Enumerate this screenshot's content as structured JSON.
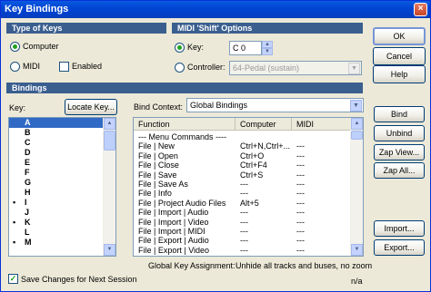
{
  "window": {
    "title": "Key Bindings",
    "close_glyph": "×"
  },
  "type_of_keys": {
    "header": "Type of Keys",
    "computer_label": "Computer",
    "midi_label": "MIDI",
    "enabled_label": "Enabled",
    "selected": "Computer"
  },
  "midi_shift": {
    "header": "MIDI 'Shift' Options",
    "key_label": "Key:",
    "key_value": "C 0",
    "controller_label": "Controller:",
    "controller_value": "64-Pedal (sustain)",
    "selected": "Key"
  },
  "dialog_buttons": {
    "ok": "OK",
    "cancel": "Cancel",
    "help": "Help"
  },
  "bindings": {
    "header": "Bindings",
    "key_label": "Key:",
    "locate_key_button": "Locate Key...",
    "bind_context_label": "Bind Context:",
    "bind_context_value": "Global Bindings",
    "keys": [
      {
        "label": "A",
        "selected": true,
        "marked": false
      },
      {
        "label": "B",
        "selected": false,
        "marked": false
      },
      {
        "label": "C",
        "selected": false,
        "marked": false
      },
      {
        "label": "D",
        "selected": false,
        "marked": false
      },
      {
        "label": "E",
        "selected": false,
        "marked": false
      },
      {
        "label": "F",
        "selected": false,
        "marked": false
      },
      {
        "label": "G",
        "selected": false,
        "marked": false
      },
      {
        "label": "H",
        "selected": false,
        "marked": false
      },
      {
        "label": "I",
        "selected": false,
        "marked": true
      },
      {
        "label": "J",
        "selected": false,
        "marked": false
      },
      {
        "label": "K",
        "selected": false,
        "marked": true
      },
      {
        "label": "L",
        "selected": false,
        "marked": false
      },
      {
        "label": "M",
        "selected": false,
        "marked": true
      }
    ],
    "marker_glyph": "▪",
    "columns": [
      "Function",
      "Computer",
      "MIDI"
    ],
    "rows": [
      {
        "function": "--- Menu Commands ----",
        "computer": "",
        "midi": ""
      },
      {
        "function": "File | New",
        "computer": "Ctrl+N,Ctrl+...",
        "midi": "---"
      },
      {
        "function": "File | Open",
        "computer": "Ctrl+O",
        "midi": "---"
      },
      {
        "function": "File | Close",
        "computer": "Ctrl+F4",
        "midi": "---"
      },
      {
        "function": "File | Save",
        "computer": "Ctrl+S",
        "midi": "---"
      },
      {
        "function": "File | Save As",
        "computer": "---",
        "midi": "---"
      },
      {
        "function": "File | Info",
        "computer": "---",
        "midi": "---"
      },
      {
        "function": "File | Project Audio Files",
        "computer": "Alt+5",
        "midi": "---"
      },
      {
        "function": "File | Import | Audio",
        "computer": "---",
        "midi": "---"
      },
      {
        "function": "File | Import | Video",
        "computer": "---",
        "midi": "---"
      },
      {
        "function": "File | Import | MIDI",
        "computer": "---",
        "midi": "---"
      },
      {
        "function": "File | Export | Audio",
        "computer": "---",
        "midi": "---"
      },
      {
        "function": "File | Export | Video",
        "computer": "---",
        "midi": "---"
      }
    ]
  },
  "side_buttons": {
    "bind": "Bind",
    "unbind": "Unbind",
    "zap_view": "Zap View...",
    "zap_all": "Zap All...",
    "import": "Import...",
    "export": "Export..."
  },
  "footer": {
    "global_label": "Global Key Assignment:",
    "global_value": "Unhide all tracks and buses, no zoom",
    "save_changes_label": "Save Changes for Next Session",
    "save_changes_checked": true,
    "checkmark": "✓",
    "status": "n/a"
  },
  "glyphs": {
    "down": "▼",
    "up": "▲"
  },
  "colors": {
    "title_bar": "#0045d4",
    "section_header": "#3a5f8f",
    "selection": "#316ac5"
  }
}
